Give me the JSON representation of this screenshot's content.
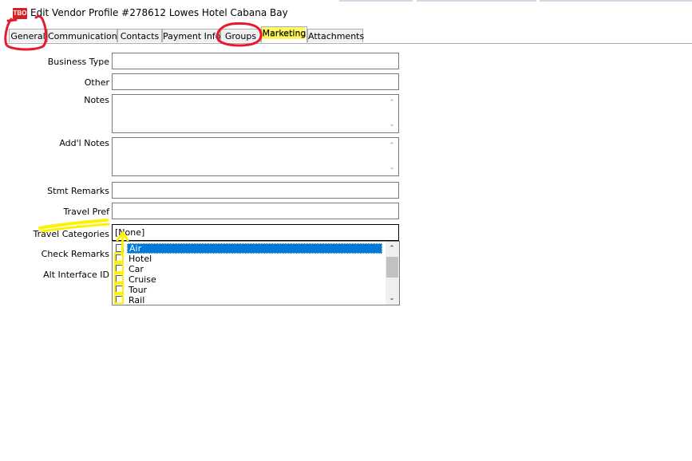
{
  "window": {
    "icon_text": "TBO",
    "title": "Edit Vendor Profile #278612 Lowes Hotel Cabana Bay"
  },
  "tabs": [
    {
      "label": "General"
    },
    {
      "label": "Communications"
    },
    {
      "label": "Contacts"
    },
    {
      "label": "Payment Info"
    },
    {
      "label": "Groups"
    },
    {
      "label": "Marketing"
    },
    {
      "label": "Attachments"
    }
  ],
  "form": {
    "business_type": {
      "label": "Business Type",
      "value": ""
    },
    "other": {
      "label": "Other",
      "value": ""
    },
    "notes": {
      "label": "Notes",
      "value": ""
    },
    "addl_notes": {
      "label": "Add'l Notes",
      "value": ""
    },
    "stmt_remarks": {
      "label": "Stmt Remarks",
      "value": ""
    },
    "travel_pref": {
      "label": "Travel Pref",
      "value": ""
    },
    "travel_categories": {
      "label": "Travel Categories",
      "value": "[None]",
      "options": [
        "Air",
        "Hotel",
        "Car",
        "Cruise",
        "Tour",
        "Rail"
      ],
      "highlighted": "Air"
    },
    "check_remarks": {
      "label": "Check Remarks",
      "value": ""
    },
    "alt_interface_id": {
      "label": "Alt Interface ID",
      "value": ""
    }
  },
  "annotations": {
    "red_circles": [
      "General",
      "Groups"
    ],
    "yellow_highlights": [
      "Marketing",
      "Travel Categories"
    ],
    "colors": {
      "red": "#e8192c",
      "yellow": "#fff200",
      "selection": "#0078d7"
    }
  }
}
